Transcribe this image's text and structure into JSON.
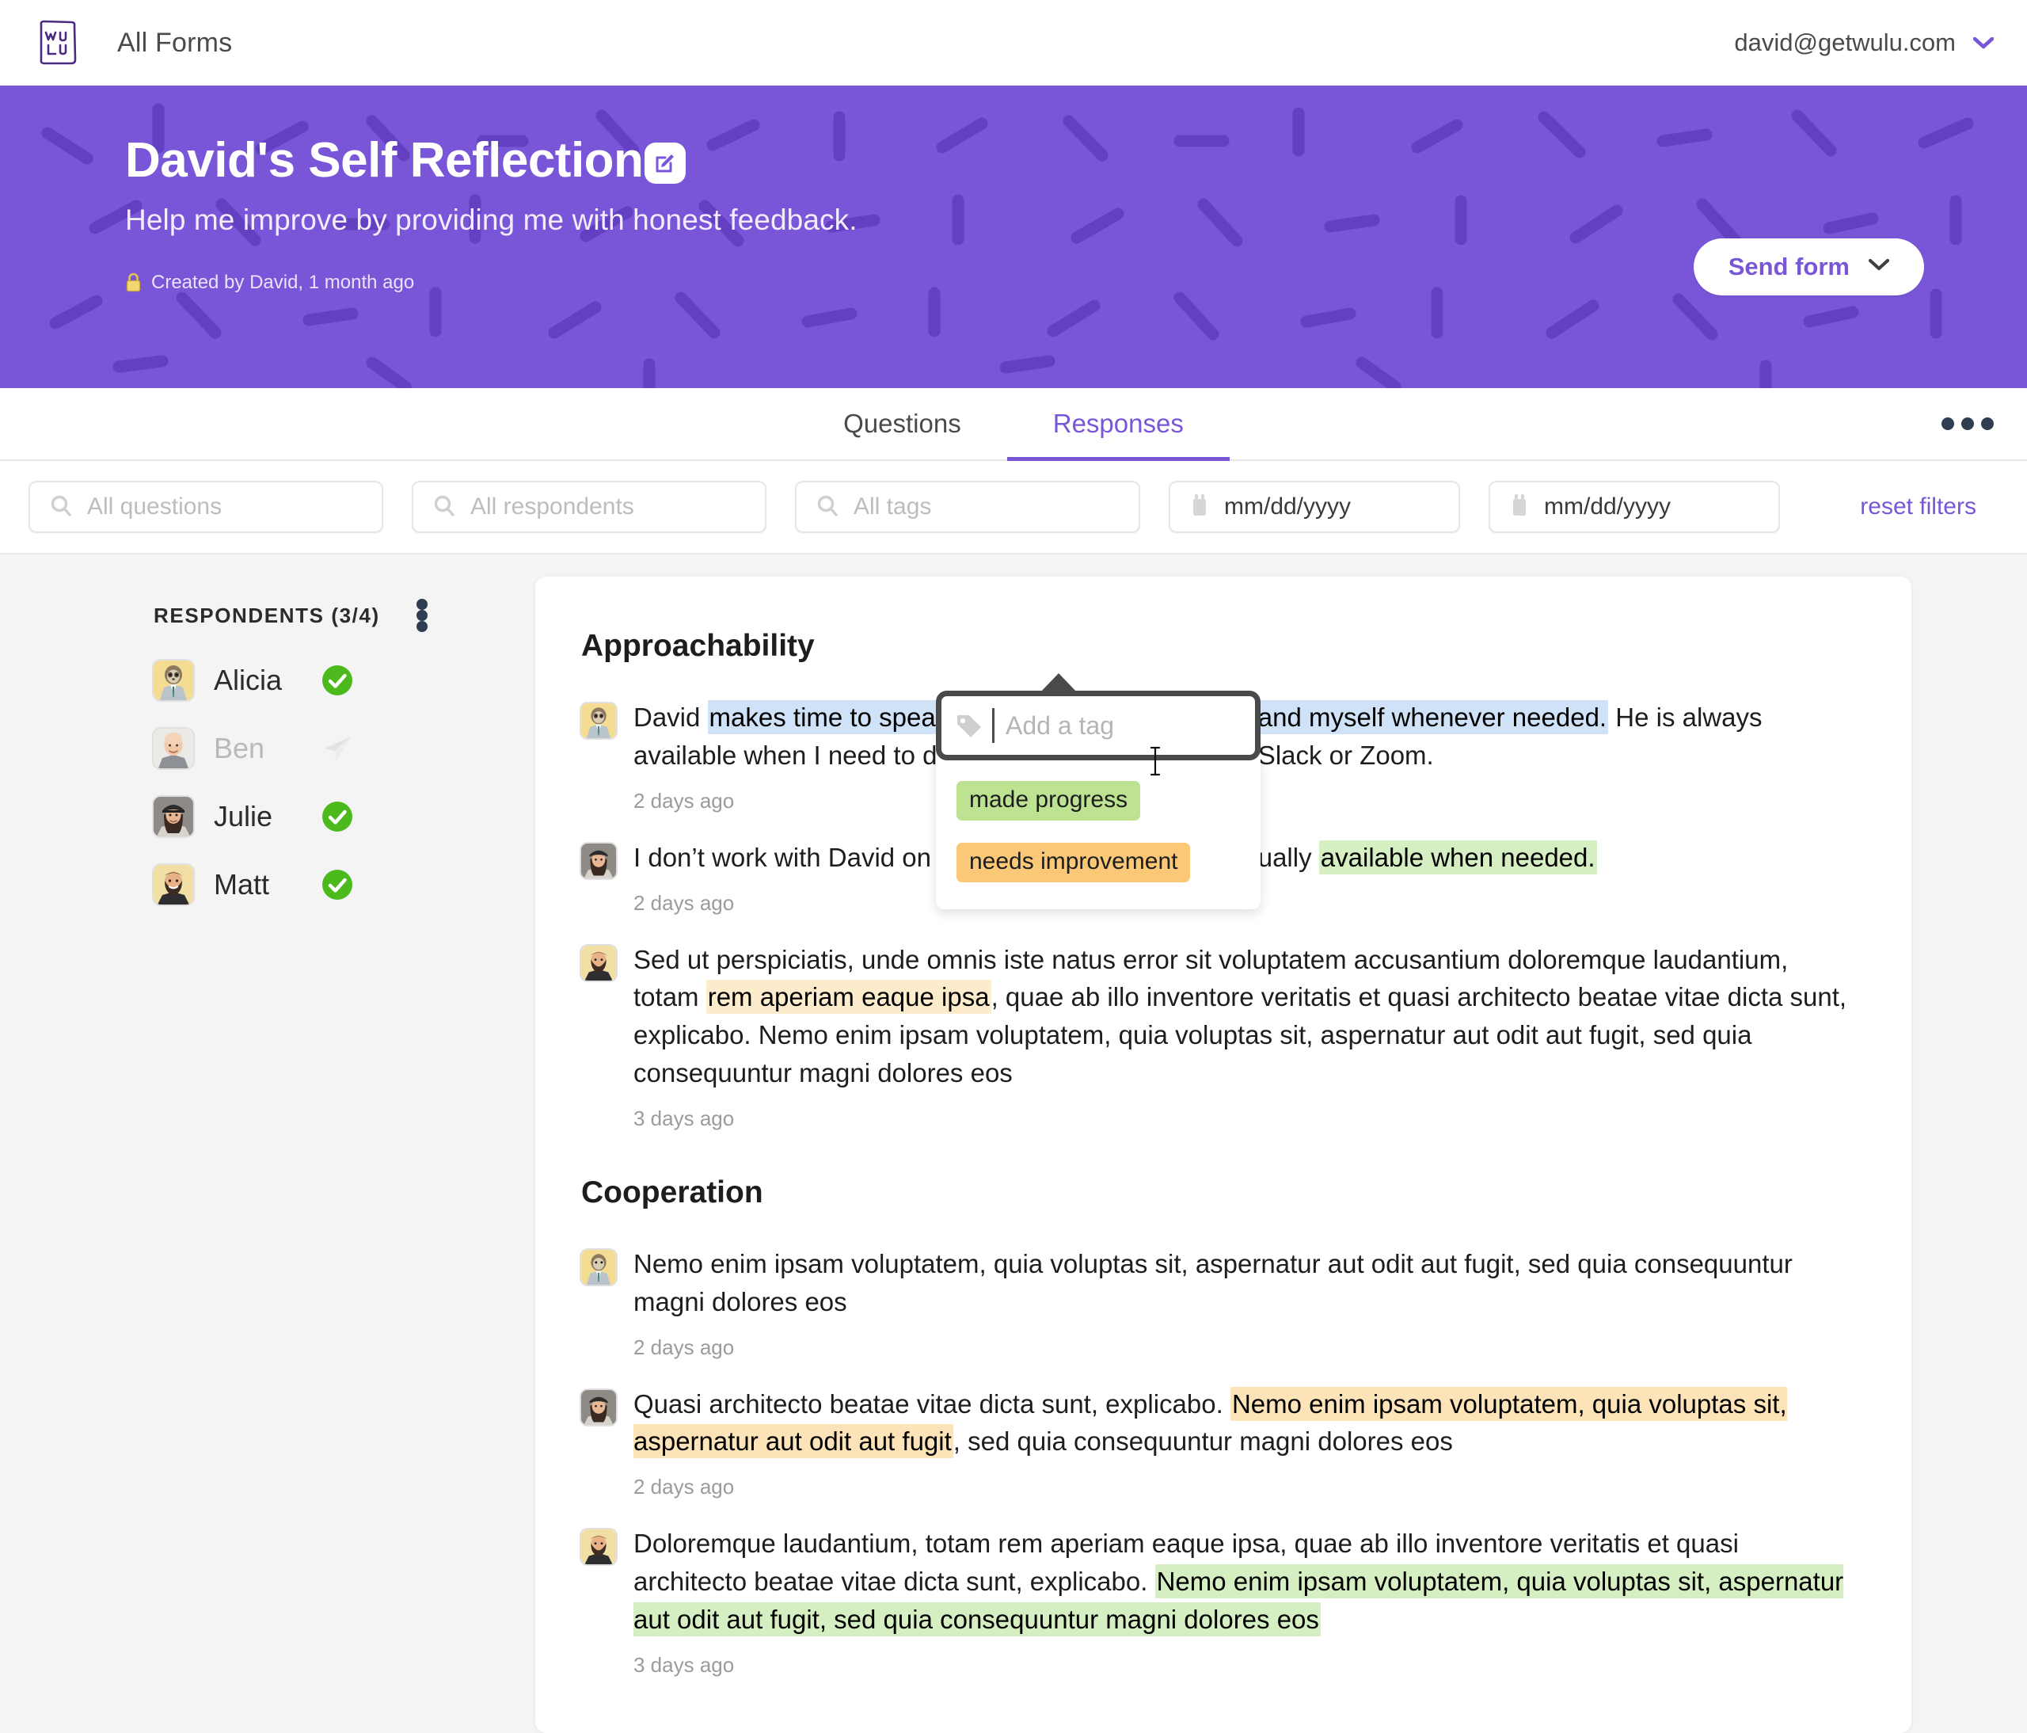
{
  "topbar": {
    "logo_text_top": "WU",
    "logo_text_bottom": "LU",
    "logo_name": "wulu-logo",
    "all_forms_label": "All Forms",
    "user_email": "david@getwulu.com",
    "chevron_icon": "chevron-down-icon"
  },
  "hero": {
    "title": "David's Self Reflection",
    "edit_icon": "edit-pencil-icon",
    "subtitle": "Help me improve by providing me with honest feedback.",
    "lock_icon": "lock-icon",
    "meta": "Created by David, 1 month ago",
    "send_form_label": "Send form",
    "send_form_chevron": "chevron-down-icon",
    "bg_color": "#7956d8",
    "confetti_color": "#6340c2"
  },
  "tabs": {
    "items": [
      {
        "label": "Questions",
        "active": false
      },
      {
        "label": "Responses",
        "active": true
      }
    ],
    "overflow_icon": "kebab-menu-icon",
    "active_color": "#7956d8"
  },
  "filters": {
    "questions_placeholder": "All questions",
    "respondents_placeholder": "All respondents",
    "tags_placeholder": "All tags",
    "date_from_placeholder": "mm/dd/yyyy",
    "date_to_placeholder": "mm/dd/yyyy",
    "search_icon": "search-icon",
    "calendar_icon": "calendar-icon",
    "reset_label": "reset filters",
    "reset_color": "#7956d8"
  },
  "sidebar": {
    "title": "RESPONDENTS (3/4)",
    "overflow_icon": "kebab-menu-icon",
    "respondents": [
      {
        "name": "Alicia",
        "status": "completed",
        "status_icon": "green-check-icon",
        "avatar": "sloth-avatar"
      },
      {
        "name": "Ben",
        "status": "pending",
        "status_icon": "paper-plane-icon",
        "avatar": "bald-man-avatar"
      },
      {
        "name": "Julie",
        "status": "completed",
        "status_icon": "green-check-icon",
        "avatar": "woman-cap-avatar"
      },
      {
        "name": "Matt",
        "status": "completed",
        "status_icon": "green-check-icon",
        "avatar": "bearded-man-avatar"
      }
    ],
    "status_color": "#4cba1c"
  },
  "sections": [
    {
      "title": "Approachability",
      "answers": [
        {
          "avatar": "sloth-avatar",
          "time": "2 days ago",
          "parts": [
            {
              "text": "David ",
              "mark": "none"
            },
            {
              "text": "makes time to speak with other team members and myself whenever needed.",
              "mark": "sel"
            },
            {
              "text": " He is always available when I need to discuss something, often via Slack or Zoom.",
              "mark": "none"
            }
          ]
        },
        {
          "avatar": "woman-cap-avatar",
          "time": "2 days ago",
          "parts": [
            {
              "text": "I don’t work with David on a regular basis, but he is usually ",
              "mark": "none"
            },
            {
              "text": "available when needed.",
              "mark": "green"
            }
          ]
        },
        {
          "avatar": "bearded-man-avatar",
          "time": "3 days ago",
          "parts": [
            {
              "text": "Sed ut perspiciatis, unde omnis iste natus error sit voluptatem accusantium doloremque laudantium, totam ",
              "mark": "none"
            },
            {
              "text": "rem aperiam eaque ipsa",
              "mark": "amber-soft"
            },
            {
              "text": ", quae ab illo inventore veritatis et quasi architecto beatae vitae dicta sunt, explicabo. Nemo enim ipsam voluptatem, quia voluptas sit, aspernatur aut odit aut fugit, sed quia consequuntur magni dolores eos",
              "mark": "none"
            }
          ]
        }
      ]
    },
    {
      "title": "Cooperation",
      "answers": [
        {
          "avatar": "sloth-avatar",
          "time": "2 days ago",
          "parts": [
            {
              "text": "Nemo enim ipsam voluptatem, quia voluptas sit, aspernatur aut odit aut fugit, sed quia consequuntur magni dolores eos",
              "mark": "none"
            }
          ]
        },
        {
          "avatar": "woman-cap-avatar",
          "time": "2 days ago",
          "parts": [
            {
              "text": "Quasi architecto beatae vitae dicta sunt, explicabo. ",
              "mark": "none"
            },
            {
              "text": "Nemo enim ipsam voluptatem, quia voluptas sit, aspernatur aut odit aut fugit",
              "mark": "amber"
            },
            {
              "text": ", sed quia consequuntur magni dolores eos",
              "mark": "none"
            }
          ]
        },
        {
          "avatar": "bearded-man-avatar",
          "time": "3 days ago",
          "parts": [
            {
              "text": "Doloremque laudantium, totam rem aperiam eaque ipsa, quae ab illo inventore veritatis et quasi architecto beatae vitae dicta sunt, explicabo. ",
              "mark": "none"
            },
            {
              "text": "Nemo enim ipsam voluptatem, quia voluptas sit, aspernatur aut odit aut fugit, sed quia consequuntur magni dolores eos",
              "mark": "green"
            }
          ]
        }
      ]
    }
  ],
  "tag_popup": {
    "tag_icon": "tag-icon",
    "input_value": "",
    "input_placeholder": "Add a tag",
    "cursor_icon": "i-beam-cursor",
    "options": [
      {
        "label": "made progress",
        "color": "#bde292"
      },
      {
        "label": "needs improvement",
        "color": "#fbc878"
      }
    ]
  }
}
